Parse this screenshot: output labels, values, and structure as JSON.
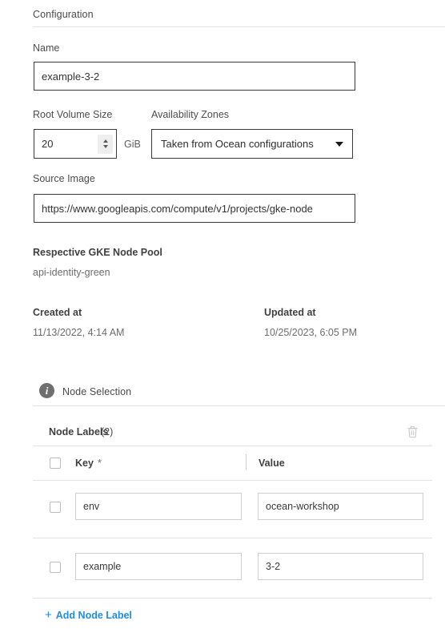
{
  "section": {
    "title": "Configuration"
  },
  "name_field": {
    "label": "Name",
    "value": "example-3-2",
    "placeholder": "Name"
  },
  "root_volume": {
    "label": "Root Volume Size",
    "value": "20",
    "unit": "GiB",
    "stepper_up_icon": "chevron-up-icon",
    "stepper_down_icon": "chevron-down-icon"
  },
  "availability_zones": {
    "label": "Availability Zones",
    "selected": "Taken from Ocean configurations",
    "caret_icon": "chevron-down-icon"
  },
  "source_image": {
    "label": "Source Image",
    "value": "https://www.googleapis.com/compute/v1/projects/gke-node",
    "placeholder": "Source Image"
  },
  "gke_node_pool": {
    "label": "Respective GKE Node Pool",
    "value": "api-identity-green"
  },
  "timestamps": [
    {
      "label": "Created at",
      "value": "11/13/2022, 4:14 AM"
    },
    {
      "label": "Updated at",
      "value": "10/25/2023, 6:05 PM"
    }
  ],
  "node_selection": {
    "title": "Node Selection",
    "info_icon": "info-icon",
    "info_glyph": "i"
  },
  "node_labels": {
    "title": "Node Labels",
    "count": "(2)",
    "delete_icon": "trash-icon",
    "columns": [
      {
        "label": "Key",
        "required_marker": "*"
      },
      {
        "label": "Value",
        "required_marker": ""
      }
    ],
    "rows": [
      {
        "key": "env",
        "value": "ocean-workshop",
        "checked": false
      },
      {
        "key": "example",
        "value": "3-2",
        "checked": false
      }
    ],
    "select_all_checked": false,
    "add_label": "Add Node Label",
    "add_icon": "plus-icon"
  },
  "colors": {
    "link": "#1f8ceb",
    "border_dark": "#3b3b3b",
    "border_light": "#cfcfcf",
    "divider": "#e3e3e3",
    "info_bg": "#6f6f6f"
  }
}
